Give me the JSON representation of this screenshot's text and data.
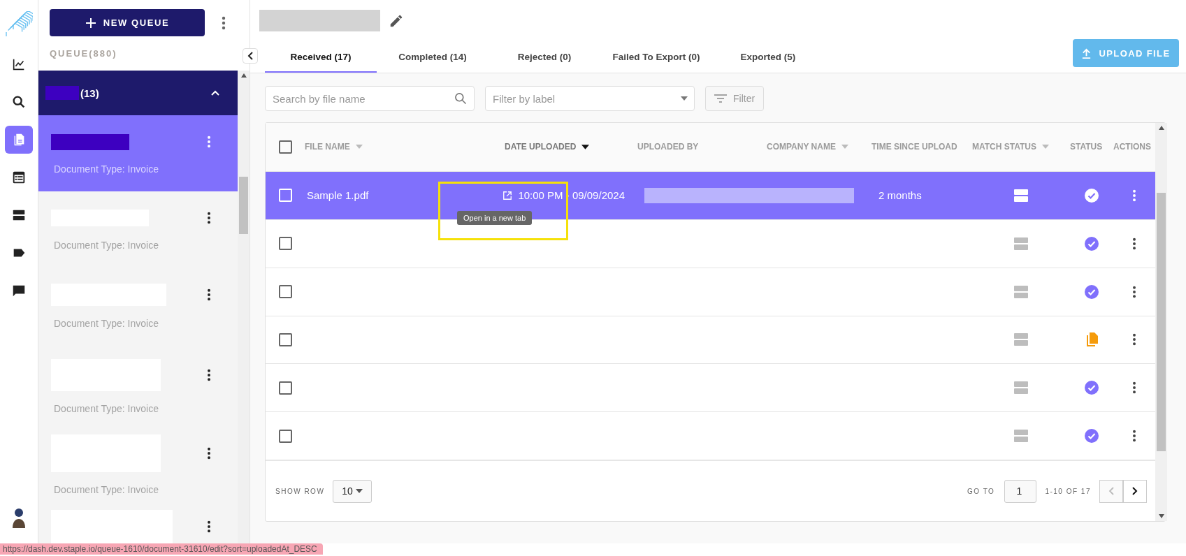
{
  "rail": {
    "items": [
      {
        "kind": "chart",
        "selected": false
      },
      {
        "kind": "search",
        "selected": false
      },
      {
        "kind": "documents",
        "selected": true
      },
      {
        "kind": "table",
        "selected": false
      },
      {
        "kind": "rows",
        "selected": false
      },
      {
        "kind": "tag",
        "selected": false
      },
      {
        "kind": "chat",
        "selected": false
      }
    ]
  },
  "queue_panel": {
    "new_queue_button": "NEW QUEUE",
    "queue_count": "QUEUE(880)",
    "group": {
      "count": "(13)",
      "expanded": true
    },
    "items": [
      {
        "subtitle": "Document Type: Invoice",
        "selected": true
      },
      {
        "subtitle": "Document Type: Invoice",
        "selected": false
      },
      {
        "subtitle": "Document Type: Invoice",
        "selected": false
      },
      {
        "subtitle": "Document Type: Invoice",
        "selected": false
      },
      {
        "subtitle": "Document Type: Invoice",
        "selected": false
      },
      {
        "selected": false
      }
    ]
  },
  "tabs": [
    {
      "label": "Received (17)",
      "selected": true
    },
    {
      "label": "Completed (14)",
      "selected": false
    },
    {
      "label": "Rejected (0)",
      "selected": false
    },
    {
      "label": "Failed To Export (0)",
      "selected": false
    },
    {
      "label": "Exported (5)",
      "selected": false
    }
  ],
  "upload_button": "UPLOAD FILE",
  "toolbar": {
    "search": {
      "placeholder": "Search by file name"
    },
    "label_filter": {
      "placeholder": "Filter by label"
    },
    "filter_button": "Filter"
  },
  "table": {
    "columns": [
      {
        "label": "FILE NAME",
        "sortable": true,
        "sorted": false
      },
      {
        "label": "DATE UPLOADED",
        "sortable": true,
        "sorted": true
      },
      {
        "label": "UPLOADED BY",
        "sortable": false,
        "sorted": false
      },
      {
        "label": "COMPANY NAME",
        "sortable": true,
        "sorted": false
      },
      {
        "label": "TIME SINCE UPLOAD",
        "sortable": false,
        "sorted": false
      },
      {
        "label": "MATCH STATUS",
        "sortable": true,
        "sorted": false
      },
      {
        "label": "STATUS",
        "sortable": false,
        "sorted": false
      },
      {
        "label": "ACTIONS",
        "sortable": false,
        "sorted": false
      }
    ],
    "select_all": {
      "checked": false
    },
    "rows": [
      {
        "selected": true,
        "checked": false,
        "file_name": "Sample 1.pdf",
        "date": "10:00 PM - 09/09/2024",
        "time_since": "2 months",
        "kind": "done"
      },
      {
        "selected": false,
        "checked": false,
        "kind": "done"
      },
      {
        "selected": false,
        "checked": false,
        "kind": "done"
      },
      {
        "selected": false,
        "checked": false,
        "kind": "file"
      },
      {
        "selected": false,
        "checked": false,
        "kind": "done"
      },
      {
        "selected": false,
        "checked": false,
        "kind": "done"
      }
    ],
    "tooltip": "Open in a new tab",
    "pagination": {
      "show_row_label": "SHOW ROW",
      "rows_per_page": "10",
      "goto_label": "GO TO",
      "page": "1",
      "range": "1-10 OF 17"
    }
  },
  "status_bar": {
    "url": "https://dash.dev.staple.io/queue-1610/document-31610/edit?sort=uploadedAt_DESC"
  }
}
